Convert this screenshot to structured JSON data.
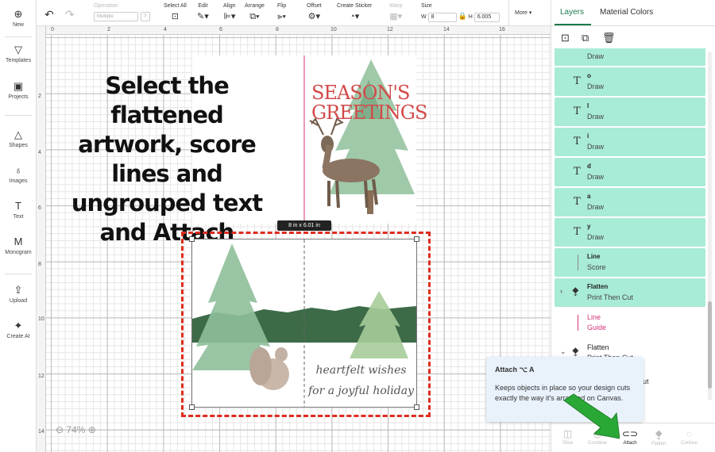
{
  "left_nav": {
    "items": [
      {
        "label": "New",
        "icon": "plus-circle-icon",
        "glyph": "⊕"
      },
      {
        "label": "Templates",
        "icon": "shirt-icon",
        "glyph": "👕"
      },
      {
        "label": "Projects",
        "icon": "projects-icon",
        "glyph": "▣"
      },
      {
        "label": "Shapes",
        "icon": "shapes-icon",
        "glyph": "△"
      },
      {
        "label": "Images",
        "icon": "bulb-icon",
        "glyph": "♁"
      },
      {
        "label": "Text",
        "icon": "text-icon",
        "glyph": "T"
      },
      {
        "label": "Monogram",
        "icon": "monogram-icon",
        "glyph": "M"
      },
      {
        "label": "Upload",
        "icon": "upload-icon",
        "glyph": "⇪"
      },
      {
        "label": "Create AI",
        "icon": "sparkle-icon",
        "glyph": "✦"
      }
    ]
  },
  "toolbar": {
    "undo": "↶",
    "redo": "↷",
    "operation_label": "Operation",
    "operation_value": "Multiple",
    "select_all": "Select All",
    "edit": "Edit",
    "align": "Align",
    "arrange": "Arrange",
    "flip": "Flip",
    "offset": "Offset",
    "create_sticker": "Create Sticker",
    "warp": "Warp",
    "size_label": "Size",
    "w_label": "W",
    "width": "8",
    "h_label": "H",
    "height": "6.005",
    "more": "More ▾"
  },
  "canvas": {
    "ruler_top": [
      "0",
      "2",
      "4",
      "6",
      "8",
      "10",
      "12",
      "14",
      "16"
    ],
    "ruler_left": [
      "2",
      "4",
      "6",
      "8",
      "10",
      "12",
      "14"
    ],
    "caption": "Select the flattened artwork, score lines and ungrouped text and Attach",
    "top_card_text": "SEASON'S GREETINGS",
    "bottom_card_text": "heartfelt wishes for a joyful holiday",
    "size_tag": "8  in x 6.01  in",
    "zoom": "74%"
  },
  "right_panel": {
    "tabs": [
      "Layers",
      "Material Colors"
    ],
    "action_icons": [
      "group-icon",
      "duplicate-icon",
      "delete-icon"
    ],
    "layers": [
      {
        "name": "",
        "type": "Draw",
        "kind": "text"
      },
      {
        "name": "o",
        "type": "Draw",
        "kind": "text"
      },
      {
        "name": "l",
        "type": "Draw",
        "kind": "text"
      },
      {
        "name": "i",
        "type": "Draw",
        "kind": "text"
      },
      {
        "name": "d",
        "type": "Draw",
        "kind": "text"
      },
      {
        "name": "a",
        "type": "Draw",
        "kind": "text"
      },
      {
        "name": "y",
        "type": "Draw",
        "kind": "text"
      },
      {
        "name": "Line",
        "type": "Score",
        "kind": "line"
      },
      {
        "name": "Flatten",
        "type": "Print Then Cut",
        "kind": "flatten"
      },
      {
        "name": "Line",
        "type": "Guide",
        "kind": "line-guide"
      },
      {
        "name": "Flatten",
        "type": "Print Then Cut",
        "kind": "flatten-plain"
      }
    ],
    "tooltip": {
      "title": "Attach ⌥ A",
      "body": "Keeps objects in place so your design cuts exactly the way it's arranged on Canvas.",
      "partial_text": "ut"
    },
    "bottom_bar": [
      {
        "label": "Slice",
        "icon": "slice-icon",
        "active": false
      },
      {
        "label": "Combine",
        "icon": "combine-icon",
        "active": false
      },
      {
        "label": "Attach",
        "icon": "attach-icon",
        "active": true
      },
      {
        "label": "Flatten",
        "icon": "flatten-icon",
        "active": false
      },
      {
        "label": "Contour",
        "icon": "contour-icon",
        "active": false
      }
    ]
  },
  "colors": {
    "accent_green": "#1a7a4c",
    "layer_highlight": "#a8ebd6",
    "selection_dash": "#e02b1e",
    "pointer_arrow": "#2aa836",
    "title_red": "#d24a4a",
    "guide_pink": "#d6337a"
  }
}
